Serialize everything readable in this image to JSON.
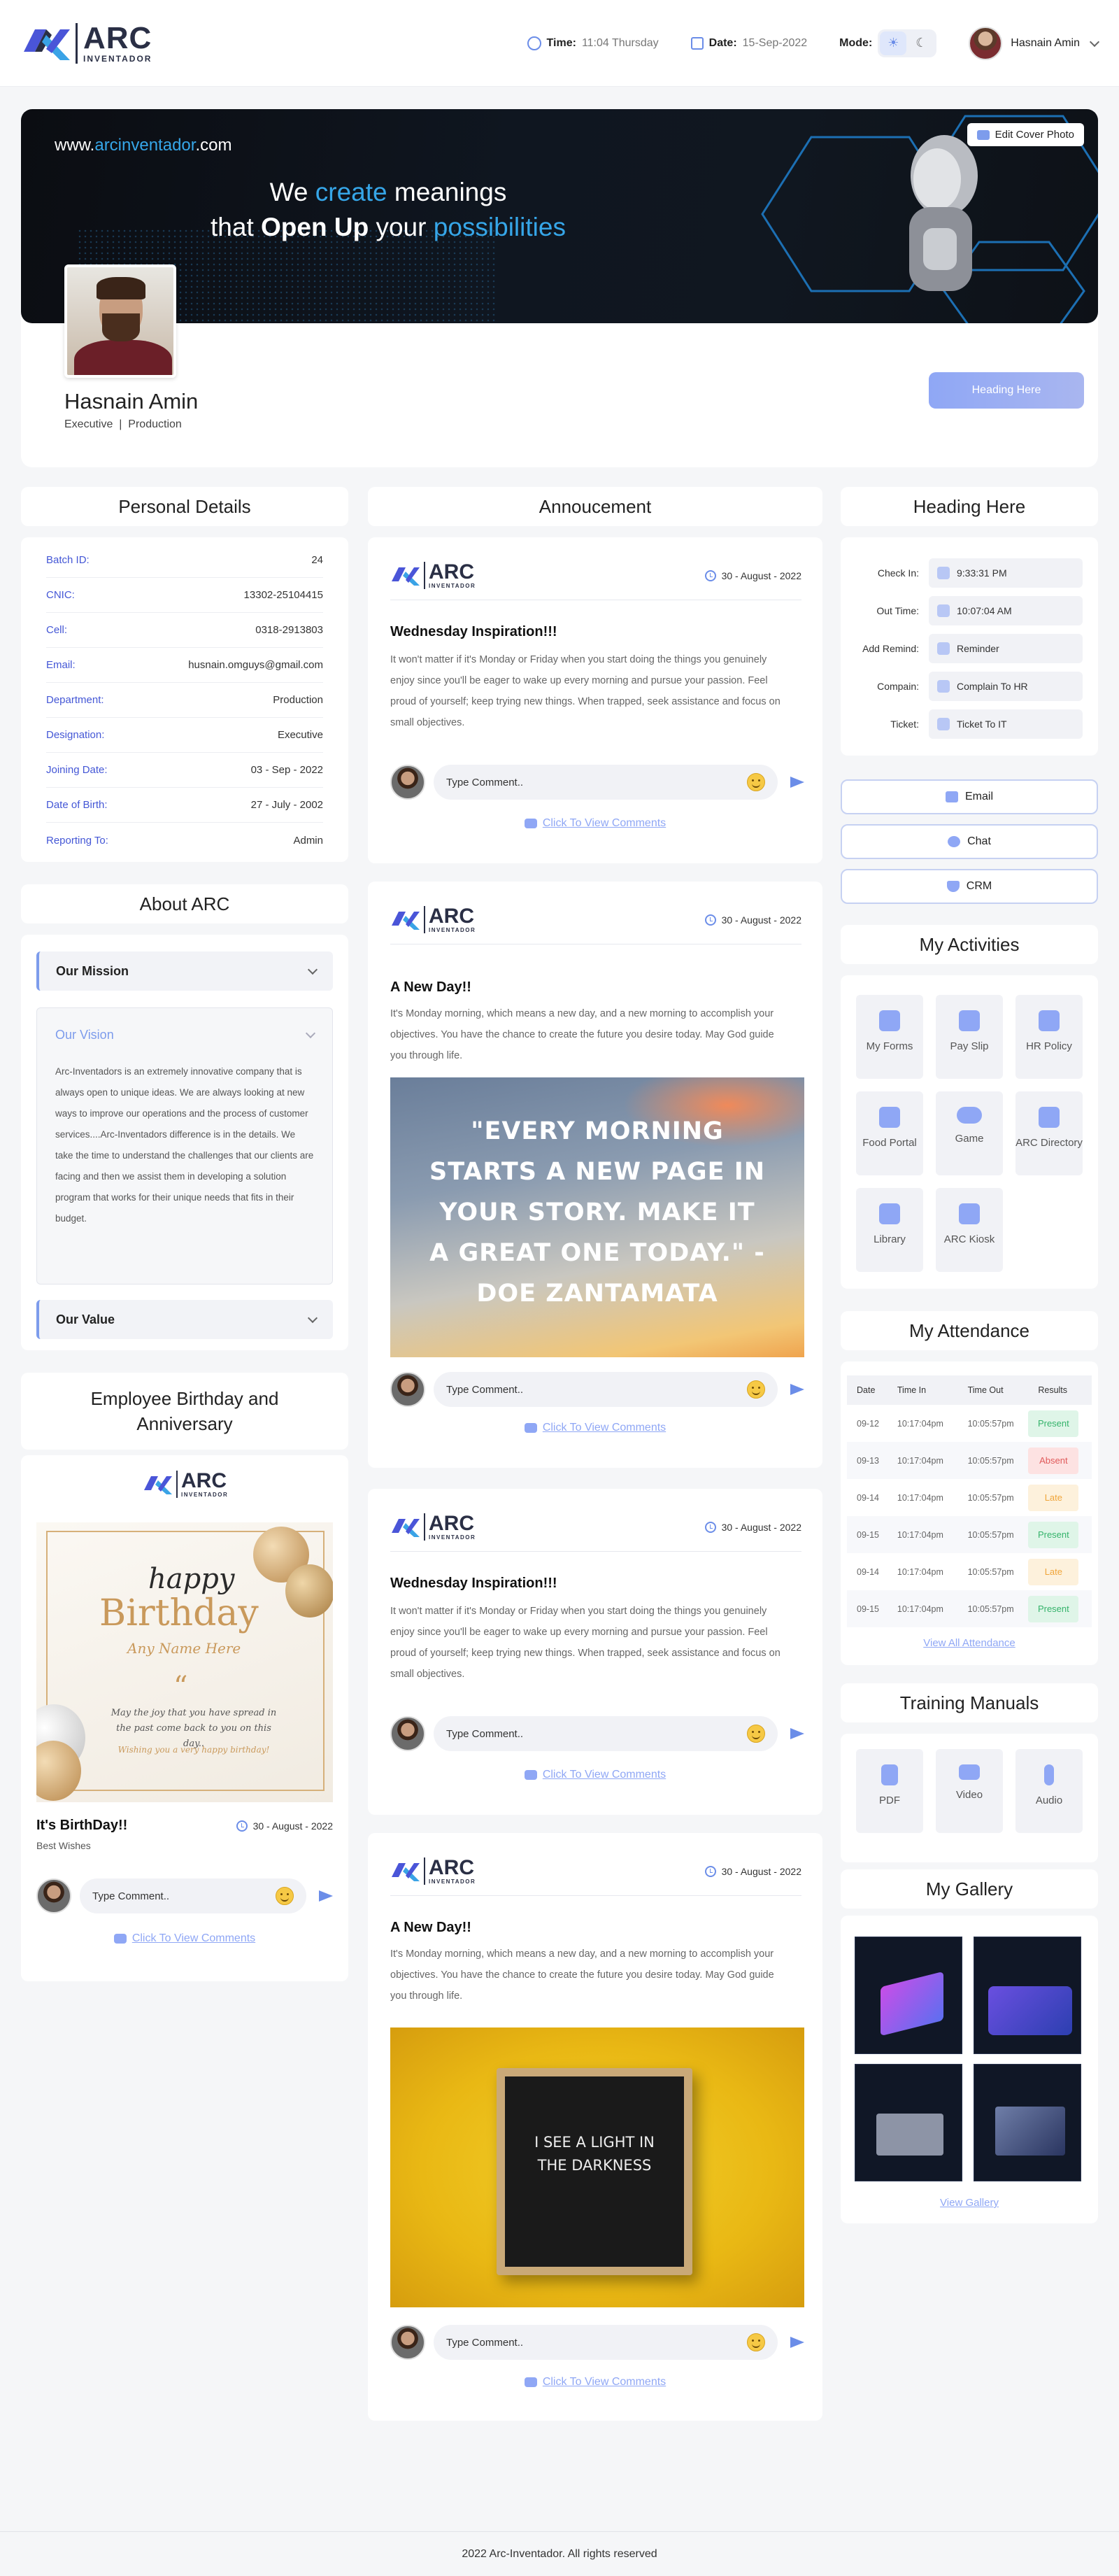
{
  "header": {
    "logo_text": "ARC",
    "logo_sub": "INVENTADOR",
    "time_label": "Time:",
    "time_value": "11:04 Thursday",
    "date_label": "Date:",
    "date_value": "15-Sep-2022",
    "mode_label": "Mode:",
    "user_name": "Hasnain Amin"
  },
  "cover": {
    "url_prefix": "www.",
    "url_highlight": "arcinventador",
    "url_suffix": ".com",
    "tagline_1a": "We ",
    "tagline_1b": "create",
    "tagline_1c": " meanings",
    "tagline_2a": "that ",
    "tagline_2b": "Open Up",
    "tagline_2c": " your ",
    "tagline_2d": "possibilities",
    "edit_label": "Edit Cover Photo"
  },
  "profile": {
    "name": "Hasnain Amin",
    "role": "Executive  |  Production",
    "heading_button": "Heading Here"
  },
  "personal": {
    "title": "Personal Details",
    "rows": [
      {
        "k": "Batch ID:",
        "v": "24"
      },
      {
        "k": "CNIC:",
        "v": "13302-25104415"
      },
      {
        "k": "Cell:",
        "v": "0318-2913803"
      },
      {
        "k": "Email:",
        "v": "husnain.omguys@gmail.com"
      },
      {
        "k": "Department:",
        "v": "Production"
      },
      {
        "k": "Designation:",
        "v": "Executive"
      },
      {
        "k": "Joining Date:",
        "v": "03 - Sep - 2022"
      },
      {
        "k": "Date of Birth:",
        "v": "27 - July - 2002"
      },
      {
        "k": "Reporting To:",
        "v": "Admin"
      }
    ]
  },
  "about": {
    "title": "About ARC",
    "mission": "Our Mission",
    "vision": "Our Vision",
    "vision_text": "Arc-Inventadors is an extremely innovative company that is always open to unique ideas. We are always looking at new ways to improve our operations and the process of customer services....Arc-Inventadors difference is in the details. We take the time to understand the challenges that our clients are facing and then we assist them in developing a solution program that works for their unique needs that fits in their budget.",
    "value": "Our Value"
  },
  "birthday": {
    "title": "Employee Birthday and Anniversary",
    "card_happy": "happy",
    "card_birthday": "Birthday",
    "card_name": "Any Name Here",
    "card_quote": "May the joy that you have spread in the past come back to you on this day..",
    "card_wish": "Wishing you a very happy birthday!",
    "post_title": "It's BirthDay!!",
    "post_sub": "Best Wishes",
    "post_date": "30 - August - 2022",
    "comment_placeholder": "Type Comment..",
    "view_comments": "Click To View Comments"
  },
  "feed": {
    "title": "Annoucement",
    "posts": [
      {
        "date": "30 - August - 2022",
        "title": "Wednesday Inspiration!!!",
        "text": "It won't matter if it's Monday or Friday when you start doing the things you genuinely enjoy since you'll be eager to wake up every morning and pursue your passion. Feel proud of yourself; keep trying new things. When trapped, seek assistance and focus on small objectives.",
        "comment": "Type Comment..",
        "view": "Click To View Comments"
      },
      {
        "date": "30 - August - 2022",
        "title": "A New Day!!",
        "text": "It's Monday morning, which means a new day, and a new morning to accomplish your objectives. You have the chance to create the future you desire today. May God guide you through life.",
        "image_text": "\"EVERY MORNING STARTS A NEW PAGE IN YOUR STORY. MAKE IT A GREAT ONE TODAY.\" - DOE ZANTAMATA",
        "comment": "Type Comment..",
        "view": "Click To View Comments"
      },
      {
        "date": "30 - August - 2022",
        "title": "Wednesday Inspiration!!!",
        "text": "It won't matter if it's Monday or Friday when you start doing the things you genuinely enjoy since you'll be eager to wake up every morning and pursue your passion. Feel proud of yourself; keep trying new things. When trapped, seek assistance and focus on small objectives.",
        "comment": "Type Comment..",
        "view": "Click To View Comments"
      },
      {
        "date": "30 - August - 2022",
        "title": "A New Day!!",
        "text": "It's Monday morning, which means a new day, and a new morning to accomplish your objectives. You have the chance to create the future you desire today. May God guide you through life.",
        "image_text": "I SEE A LIGHT IN THE DARKNESS",
        "comment": "Type Comment..",
        "view": "Click To View Comments"
      }
    ]
  },
  "right": {
    "heading": "Heading Here",
    "checkin_label": "Check In:",
    "checkin_value": "9:33:31 PM",
    "out_label": "Out Time:",
    "out_value": "10:07:04 AM",
    "remind_label": "Add Remind:",
    "remind_value": "Reminder",
    "complain_label": "Compain:",
    "complain_value": "Complain To HR",
    "ticket_label": "Ticket:",
    "ticket_value": "Ticket To IT",
    "email_btn": "Email",
    "chat_btn": "Chat",
    "crm_btn": "CRM"
  },
  "activities": {
    "title": "My Activities",
    "items": [
      "My Forms",
      "Pay Slip",
      "HR Policy",
      "Food Portal",
      "Game",
      "ARC Directory",
      "Library",
      "ARC Kiosk"
    ]
  },
  "attendance": {
    "title": "My Attendance",
    "headers": [
      "Date",
      "Time In",
      "Time Out",
      "Results"
    ],
    "rows": [
      [
        "09-12",
        "10:17:04pm",
        "10:05:57pm",
        "Present"
      ],
      [
        "09-13",
        "10:17:04pm",
        "10:05:57pm",
        "Absent"
      ],
      [
        "09-14",
        "10:17:04pm",
        "10:05:57pm",
        "Late"
      ],
      [
        "09-15",
        "10:17:04pm",
        "10:05:57pm",
        "Present"
      ],
      [
        "09-14",
        "10:17:04pm",
        "10:05:57pm",
        "Late"
      ],
      [
        "09-15",
        "10:17:04pm",
        "10:05:57pm",
        "Present"
      ]
    ],
    "view_all": "View All Attendance"
  },
  "training": {
    "title": "Training Manuals",
    "items": [
      "PDF",
      "Video",
      "Audio"
    ]
  },
  "gallery": {
    "title": "My Gallery",
    "view": "View Gallery"
  },
  "footer": "2022 Arc-Inventador. All rights reserved"
}
